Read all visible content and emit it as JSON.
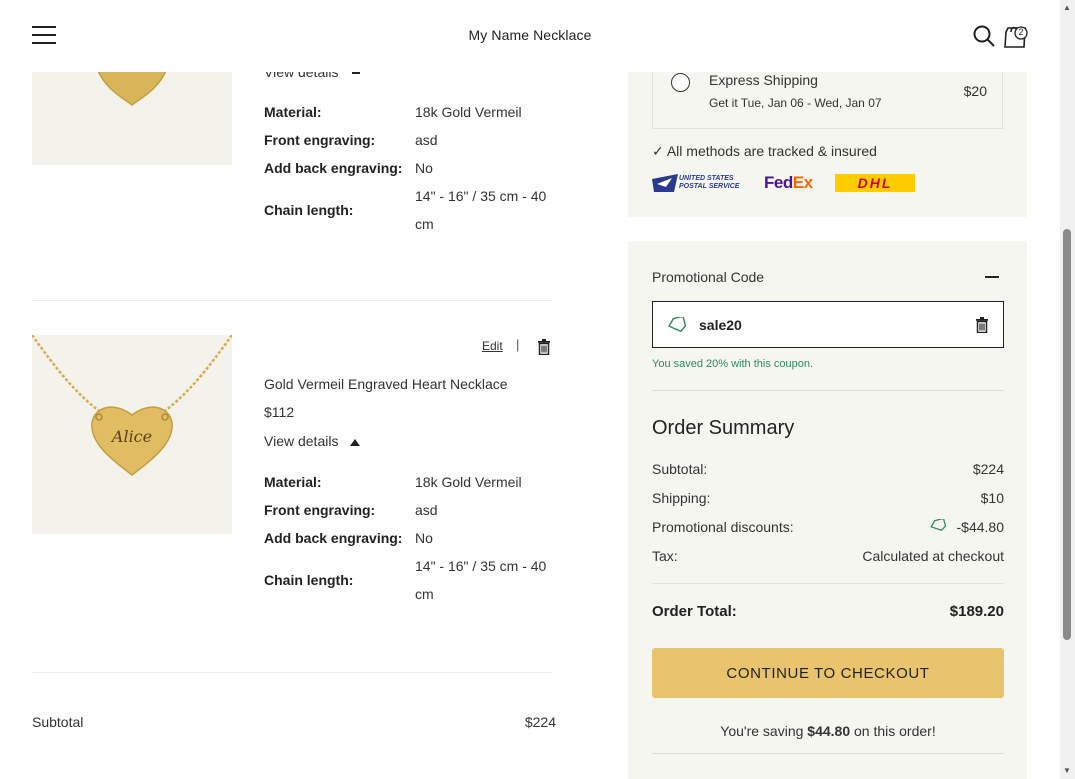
{
  "header": {
    "brand": "My Name Necklace",
    "cart_count": "2"
  },
  "item1": {
    "view_details": "View details",
    "specs": [
      {
        "label": "Material:",
        "value": "18k Gold Vermeil"
      },
      {
        "label": "Front engraving:",
        "value": "asd"
      },
      {
        "label": "Add back engraving:",
        "value": "No"
      },
      {
        "label": "Chain length:",
        "value_line1": "14\" - 16\" / 35 cm - 40",
        "value_line2": "cm"
      }
    ]
  },
  "item2": {
    "edit": "Edit",
    "separator": "|",
    "name": "Gold Vermeil Engraved Heart Necklace",
    "price": "$112",
    "engraving_text": "Alice",
    "view_details": "View details",
    "specs": [
      {
        "label": "Material:",
        "value": "18k Gold Vermeil"
      },
      {
        "label": "Front engraving:",
        "value": "asd"
      },
      {
        "label": "Add back engraving:",
        "value": "No"
      },
      {
        "label": "Chain length:",
        "value_line1": "14\" - 16\" / 35 cm - 40",
        "value_line2": "cm"
      }
    ]
  },
  "cart_subtotal": {
    "label": "Subtotal",
    "value": "$224"
  },
  "shipping": {
    "option_name": "Express Shipping",
    "option_eta": "Get it Tue, Jan 06 - Wed, Jan 07",
    "option_price": "$20",
    "tracked_note": "✓ All methods are tracked & insured",
    "carriers": {
      "usps_line1": "UNITED STATES",
      "usps_line2": "POSTAL SERVICE",
      "fedex_a": "Fed",
      "fedex_b": "Ex",
      "dhl": "DHL"
    }
  },
  "promo": {
    "title": "Promotional Code",
    "code": "sale20",
    "message": "You saved 20% with this coupon."
  },
  "summary": {
    "title": "Order Summary",
    "subtotal_label": "Subtotal:",
    "subtotal_value": "$224",
    "shipping_label": "Shipping:",
    "shipping_value": "$10",
    "discount_label": "Promotional discounts:",
    "discount_value": "-$44.80",
    "tax_label": "Tax:",
    "tax_value": "Calculated at checkout",
    "total_label": "Order Total:",
    "total_value": "$189.20",
    "checkout_label": "CONTINUE TO CHECKOUT",
    "saving_prefix": "You're saving ",
    "saving_amount": "$44.80",
    "saving_suffix": " on this order!"
  },
  "colors": {
    "accent_button": "#e9c46e",
    "panel_bg": "#f6f6f0",
    "success_text": "#2f8a5b",
    "gold": "#d9b55a"
  }
}
